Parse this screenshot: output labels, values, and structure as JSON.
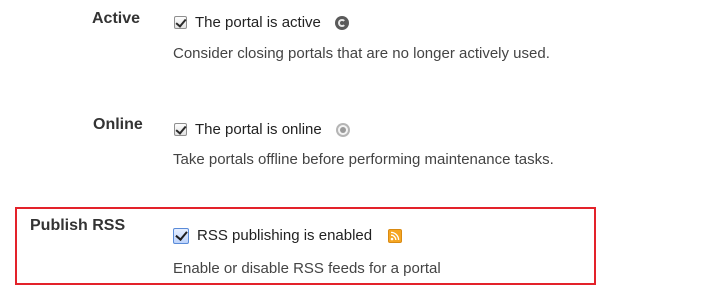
{
  "settings": {
    "active": {
      "label": "Active",
      "checkbox_label": "The portal is active",
      "checked": true,
      "icon": "status-active-icon",
      "description": "Consider closing portals that are no longer actively used."
    },
    "online": {
      "label": "Online",
      "checkbox_label": "The portal is online",
      "checked": true,
      "icon": "status-online-icon",
      "description": "Take portals offline before performing maintenance tasks."
    },
    "publish_rss": {
      "label": "Publish RSS",
      "checkbox_label": "RSS publishing is enabled",
      "checked": true,
      "icon": "rss-icon",
      "description": "Enable or disable RSS feeds for a portal"
    }
  },
  "colors": {
    "highlight_border": "#e3222a",
    "rss_orange": "#f5a623",
    "checkbox_blue": "#5a8bd8"
  }
}
